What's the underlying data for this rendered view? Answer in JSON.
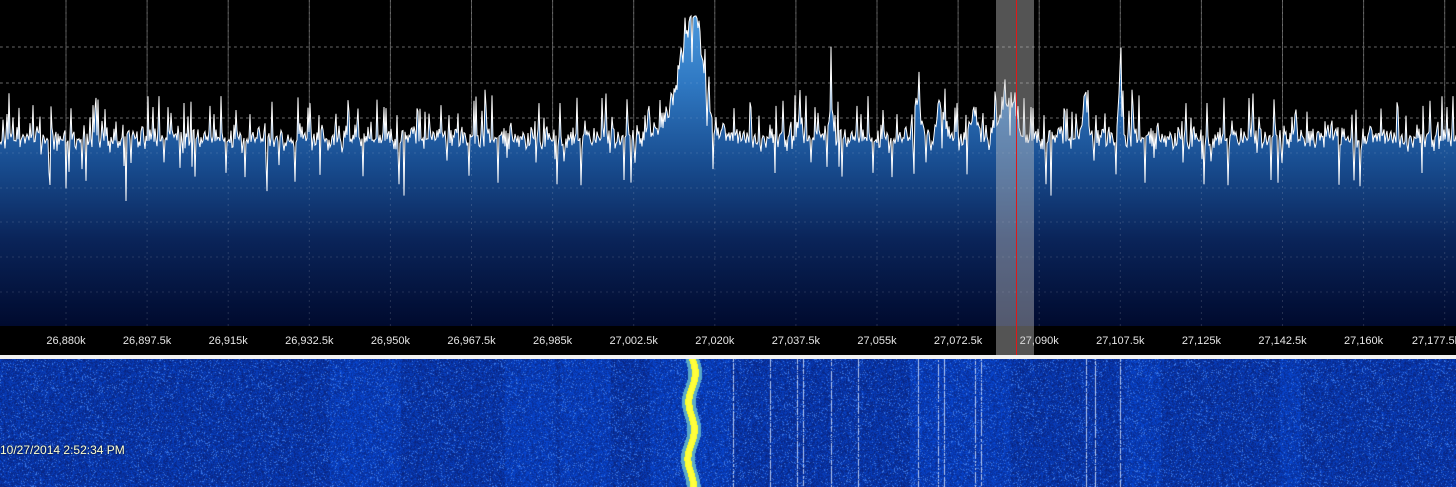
{
  "spectrum": {
    "frequency_labels": [
      "26,880k",
      "26,897.5k",
      "26,915k",
      "26,932.5k",
      "26,950k",
      "26,967.5k",
      "26,985k",
      "27,002.5k",
      "27,020k",
      "27,037.5k",
      "27,055k",
      "27,072.5k",
      "27,090k",
      "27,107.5k",
      "27,125k",
      "27,142.5k",
      "27,160k",
      "27,177.5k"
    ],
    "fft_fill_top_color": "#3a86d0",
    "fft_fill_bottom_color": "#000a2e",
    "trace_color": "#ffffff",
    "grid_color": "#5a5a5a",
    "tuning_line_color": "#e01818"
  },
  "waterfall": {
    "timestamp": "10/27/2014 2:52:34 PM",
    "background_color": "#06104c",
    "signal_color": "#ffff40"
  }
}
